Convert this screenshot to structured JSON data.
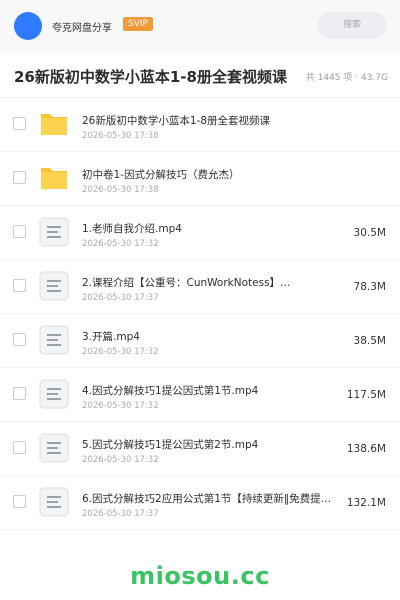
{
  "header": {
    "brand": "夸克网盘分享",
    "badge": "SVIP",
    "search_label": "搜索"
  },
  "share": {
    "title": "26新版初中数学小蓝本1-8册全套视频课",
    "summary": "共 1445 项 · 43.7G"
  },
  "files": [
    {
      "type": "folder",
      "name": "26新版初中数学小蓝本1-8册全套视频课",
      "date": "2026-05-30 17:38",
      "size": ""
    },
    {
      "type": "folder",
      "name": "初中卷1-因式分解技巧（费允杰）",
      "date": "2026-05-30 17:38",
      "size": ""
    },
    {
      "type": "file",
      "name": "1.老师自我介绍.mp4",
      "date": "2026-05-30 17:32",
      "size": "30.5M"
    },
    {
      "type": "file",
      "name": "2.课程介绍【公重号：CunWorkNotess】…",
      "date": "2026-05-30 17:37",
      "size": "78.3M"
    },
    {
      "type": "file",
      "name": "3.开篇.mp4",
      "date": "2026-05-30 17:32",
      "size": "38.5M"
    },
    {
      "type": "file",
      "name": "4.因式分解技巧1提公因式第1节.mp4",
      "date": "2026-05-30 17:32",
      "size": "117.5M"
    },
    {
      "type": "file",
      "name": "5.因式分解技巧1提公因式第2节.mp4",
      "date": "2026-05-30 17:32",
      "size": "138.6M"
    },
    {
      "type": "file",
      "name": "6.因式分解技巧2应用公式第1节【持续更新‖免费提…",
      "date": "2026-05-30 17:37",
      "size": "132.1M"
    }
  ],
  "watermark": "miosou.cc",
  "colors": {
    "accent": "#2f7bff",
    "badge": "#f39b3b",
    "folder": "#f8c532",
    "watermark": "#3cc463"
  }
}
